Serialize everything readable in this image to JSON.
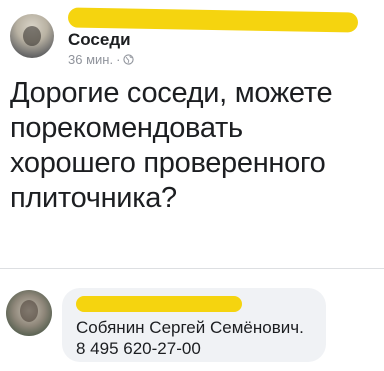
{
  "post": {
    "group_name": "Соседи",
    "time": "36 мин.",
    "separator": "·",
    "privacy_icon": "globe-icon",
    "text": "Дорогие соседи, можете порекомендовать хорошего проверенного плиточника?"
  },
  "comment": {
    "line1": "Собянин Сергей Семёнович.",
    "line2": "8 495 620-27-00"
  },
  "colors": {
    "redaction": "#f5d40f",
    "bubble": "#f0f2f5",
    "meta_text": "#90949c"
  }
}
